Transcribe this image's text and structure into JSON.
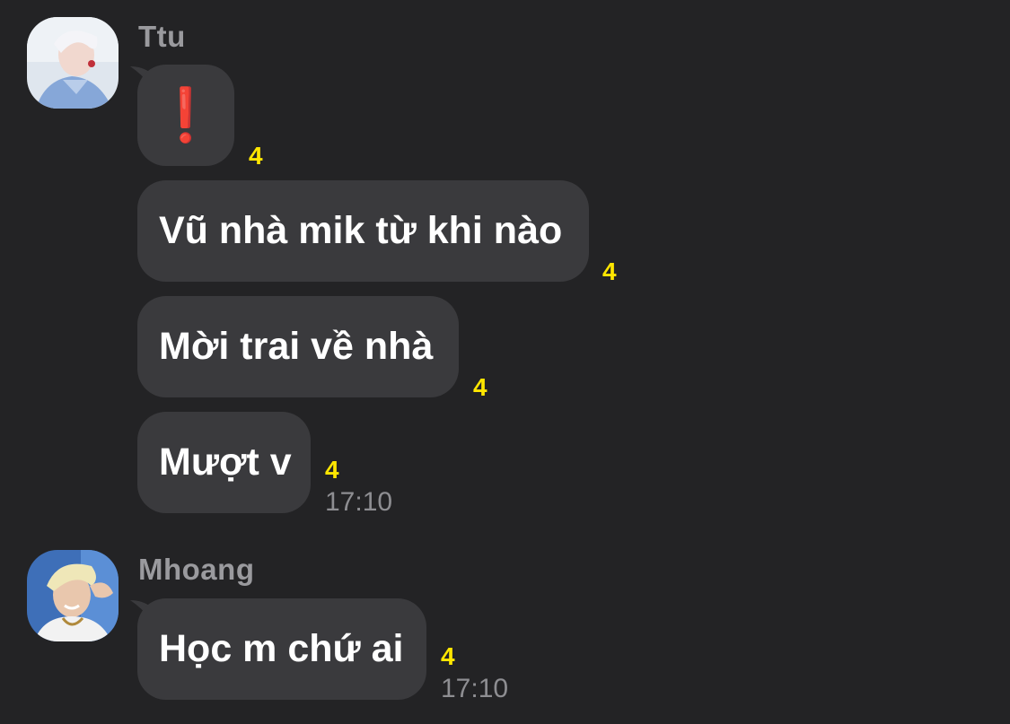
{
  "groups": [
    {
      "sender": "Ttu",
      "avatar": "avatar-ttu",
      "messages": [
        {
          "text": "❗",
          "count": "4"
        },
        {
          "text": "Vũ nhà mik từ khi nào",
          "count": "4"
        },
        {
          "text": "Mời trai về nhà",
          "count": "4"
        },
        {
          "text": "Mượt v",
          "count": "4",
          "time": "17:10"
        }
      ]
    },
    {
      "sender": "Mhoang",
      "avatar": "avatar-mhoang",
      "messages": [
        {
          "text": "Học m chứ ai",
          "count": "4",
          "time": "17:10"
        }
      ]
    }
  ],
  "colors": {
    "background": "#232325",
    "bubble": "#3a3a3d",
    "unread_count": "#ffe600",
    "exclamation": "#e0161e"
  }
}
